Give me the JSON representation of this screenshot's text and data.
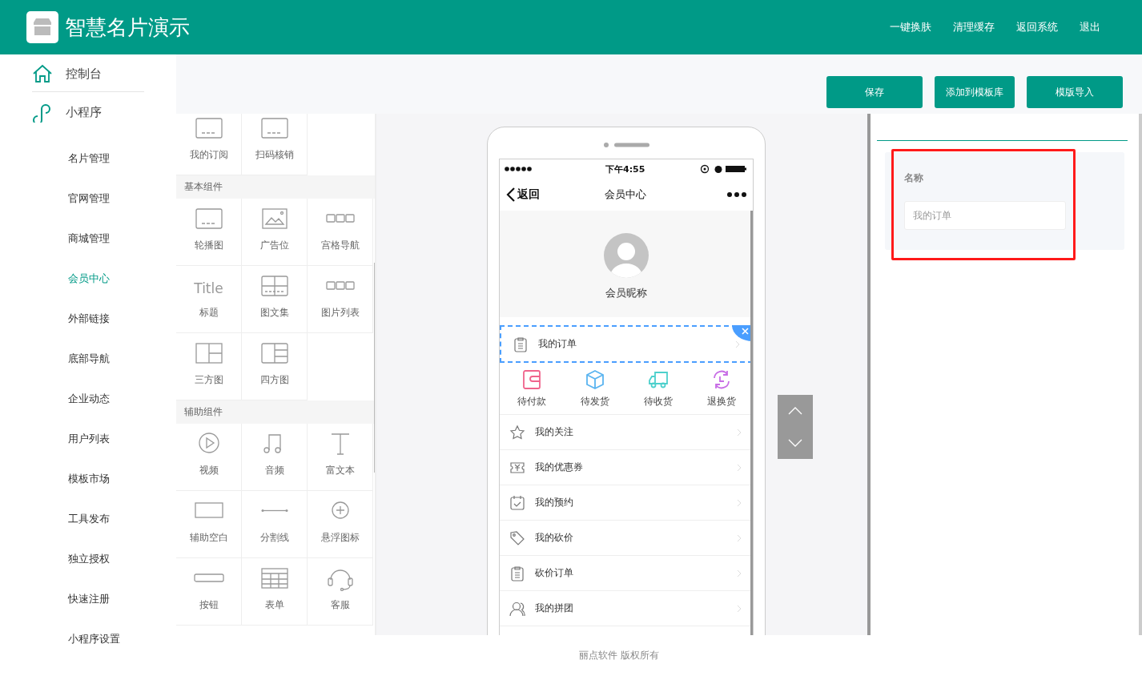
{
  "header": {
    "title": "智慧名片演示",
    "links": [
      "一键换肤",
      "清理缓存",
      "返回系统",
      "退出"
    ]
  },
  "sidebar": {
    "top_items": [
      {
        "label": "控制台",
        "kind": "home"
      },
      {
        "label": "小程序",
        "kind": "mini"
      }
    ],
    "sub_items": [
      {
        "label": "名片管理",
        "selected": false
      },
      {
        "label": "官网管理",
        "selected": false
      },
      {
        "label": "商城管理",
        "selected": false
      },
      {
        "label": "会员中心",
        "selected": true
      },
      {
        "label": "外部链接",
        "selected": false
      },
      {
        "label": "底部导航",
        "selected": false
      },
      {
        "label": "企业动态",
        "selected": false
      },
      {
        "label": "用户列表",
        "selected": false
      },
      {
        "label": "模板市场",
        "selected": false
      },
      {
        "label": "工具发布",
        "selected": false
      },
      {
        "label": "独立授权",
        "selected": false
      },
      {
        "label": "快速注册",
        "selected": false
      },
      {
        "label": "小程序设置",
        "selected": false
      }
    ]
  },
  "toolbar": {
    "buttons": [
      "保存",
      "添加到模板库",
      "模版导入"
    ]
  },
  "components": {
    "sections": [
      {
        "items": [
          {
            "label": "我的订阅",
            "kind": "card"
          },
          {
            "label": "扫码核销",
            "kind": "card"
          }
        ]
      },
      {
        "title": "基本组件",
        "items": [
          {
            "label": "轮播图",
            "kind": "card"
          },
          {
            "label": "广告位",
            "kind": "image"
          },
          {
            "label": "宫格导航",
            "kind": "squares"
          },
          {
            "label": "标题",
            "kind": "title",
            "icon_text": "Title"
          },
          {
            "label": "图文集",
            "kind": "gallery"
          },
          {
            "label": "图片列表",
            "kind": "squares"
          },
          {
            "label": "三方图",
            "kind": "three"
          },
          {
            "label": "四方图",
            "kind": "four"
          }
        ]
      },
      {
        "title": "辅助组件",
        "items": [
          {
            "label": "视频",
            "kind": "video"
          },
          {
            "label": "音频",
            "kind": "audio"
          },
          {
            "label": "富文本",
            "kind": "text"
          },
          {
            "label": "辅助空白",
            "kind": "blank"
          },
          {
            "label": "分割线",
            "kind": "line"
          },
          {
            "label": "悬浮图标",
            "kind": "float"
          },
          {
            "label": "按钮",
            "kind": "button"
          },
          {
            "label": "表单",
            "kind": "form"
          },
          {
            "label": "客服",
            "kind": "service"
          }
        ]
      }
    ]
  },
  "phone": {
    "status": {
      "time": "下午4:55"
    },
    "nav": {
      "back": "返回",
      "title": "会员中心"
    },
    "profile": {
      "nickname": "会员昵称"
    },
    "order_row": {
      "label": "我的订单",
      "selected": true
    },
    "order_status": [
      {
        "label": "待付款",
        "kind": "wallet",
        "color": "#f0648c"
      },
      {
        "label": "待发货",
        "kind": "box",
        "color": "#5ab4f0"
      },
      {
        "label": "待收货",
        "kind": "truck",
        "color": "#4dd0cc"
      },
      {
        "label": "退换货",
        "kind": "exchange",
        "color": "#c86ee6"
      }
    ],
    "menu": [
      {
        "label": "我的关注",
        "kind": "star"
      },
      {
        "label": "我的优惠券",
        "kind": "coupon"
      },
      {
        "label": "我的预约",
        "kind": "calendar"
      },
      {
        "label": "我的砍价",
        "kind": "tag"
      },
      {
        "label": "砍价订单",
        "kind": "clipboard"
      },
      {
        "label": "我的拼团",
        "kind": "people"
      }
    ]
  },
  "settings": {
    "highlighted": true,
    "field": {
      "label": "名称",
      "value": "我的订单"
    }
  },
  "footer": "丽点软件 版权所有"
}
